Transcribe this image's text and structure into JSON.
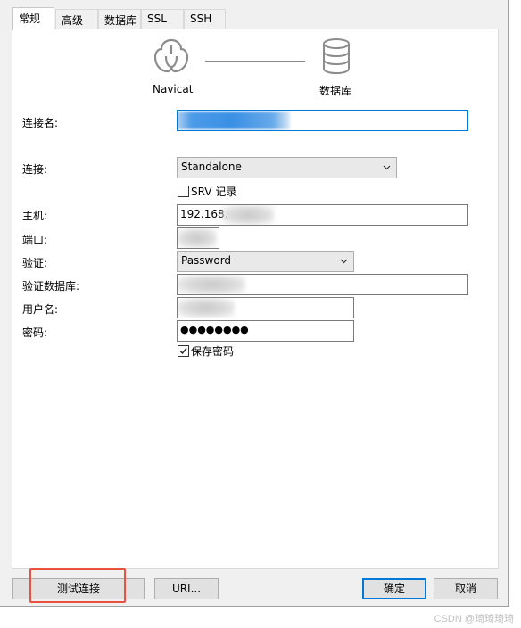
{
  "tabs": [
    {
      "label": "常规",
      "active": true
    },
    {
      "label": "高级",
      "active": false
    },
    {
      "label": "数据库",
      "active": false
    },
    {
      "label": "SSL",
      "active": false
    },
    {
      "label": "SSH",
      "active": false
    }
  ],
  "connection_graphic": {
    "left_label": "Navicat",
    "right_label": "数据库"
  },
  "form": {
    "connection_name_label": "连接名:",
    "connection_label": "连接:",
    "connection_type": "Standalone",
    "srv_label": "SRV 记录",
    "srv_checked": false,
    "host_label": "主机:",
    "host_value": "192.168.",
    "port_label": "端口:",
    "auth_label": "验证:",
    "auth_value": "Password",
    "auth_db_label": "验证数据库:",
    "username_label": "用户名:",
    "password_label": "密码:",
    "password_value": "●●●●●●●●",
    "save_password_label": "保存密码",
    "save_password_checked": true
  },
  "footer": {
    "test_connection": "测试连接",
    "uri": "URI...",
    "ok": "确定",
    "cancel": "取消"
  },
  "watermark": "CSDN @琦琦琦琦",
  "colors": {
    "accent": "#0078d7",
    "highlight": "#e8523f"
  }
}
